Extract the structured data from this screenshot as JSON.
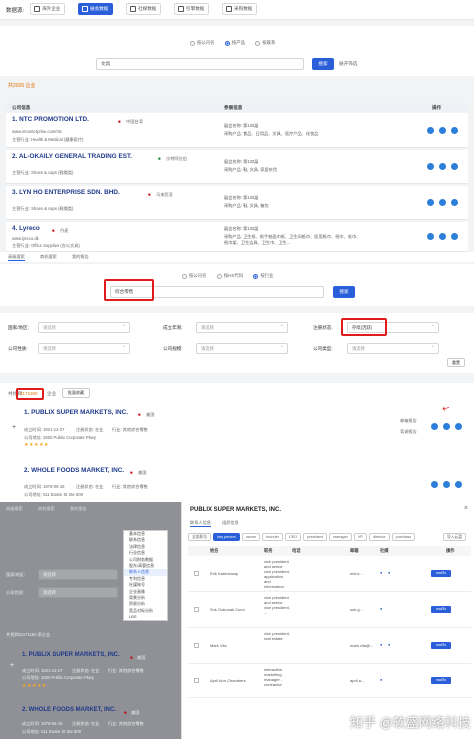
{
  "top": {
    "label": "数据源:",
    "tabs": [
      {
        "label": "海外企业",
        "active": false
      },
      {
        "label": "展会数据",
        "active": true
      },
      {
        "label": "社媒数据",
        "active": false
      },
      {
        "label": "引擎数据",
        "active": false
      },
      {
        "label": "采购数据",
        "active": false
      }
    ]
  },
  "search1": {
    "options": [
      "按公司名",
      "按产品",
      "按联系"
    ],
    "selected": 1,
    "value": "文具",
    "button": "搜索",
    "expand": "展开筛选"
  },
  "results1": {
    "count": "共2026 企业",
    "col_company": "公司信息",
    "col_params": "参展信息",
    "col_actions": "操作",
    "rows": [
      {
        "name": "1. NTC PROMOTION LTD.",
        "country": "中国台湾",
        "url": "www.ntcenterprise.com/ntc",
        "industry": "主营行业: Health & Medical (健康医疗)",
        "p1": "展会名称: 第132届",
        "p2": "采购产品: 食品、日用品、文具、医疗产品、化妆品"
      },
      {
        "name": "2. AL-OKAILY GENERAL TRADING EST.",
        "country": "沙特阿拉伯",
        "url": "",
        "industry": "主营行业: Shoes & caps (鞋帽类)",
        "p1": "展会名称: 第132届",
        "p2": "采购产品: 鞋, 文具, 家居杂货"
      },
      {
        "name": "3. LYN HO ENTERPRISE SDN. BHD.",
        "country": "马来西亚",
        "url": "",
        "industry": "主营行业: Shoes & caps (鞋帽类)",
        "p1": "展会名称: 第132届",
        "p2": "采购产品: 鞋, 文具, 箱包"
      },
      {
        "name": "4. Lyreco",
        "country": "丹麦",
        "url": "www.lyreco.dk",
        "industry": "主营行业: Office Supplies (办公文具)",
        "p1": "展会名称: 第132届",
        "p2": "采购产品: 卫生纸、纸手帕面巾纸、卫生间纸巾、医用纸巾、纸巾、毛巾、纸巾架、卫生洁具、卫生巾、卫生..."
      }
    ],
    "subtabs": [
      "高级搜索",
      "商机搜索",
      "我的报告"
    ]
  },
  "search2": {
    "options": [
      "按公司名",
      "按HS代码",
      "按行业"
    ],
    "selected": 2,
    "value": "综合零售",
    "button": "搜索"
  },
  "filters": {
    "country_label": "国家/地区:",
    "country_value": "请选择",
    "founded_label": "成立年限:",
    "founded_value": "请选择",
    "status_label": "注册状态:",
    "status_value": "存续(活跃)",
    "nature_label": "公司性质:",
    "nature_value": "请选择",
    "size_label": "公司规模:",
    "size_value": "请选择",
    "type_label": "公司类型:",
    "type_value": "请选择",
    "reset": "重置"
  },
  "results2": {
    "count_prefix": "共找到",
    "count": "2171180",
    "count_suffix": "企业",
    "batch": "批量收藏",
    "rows": [
      {
        "name": "1. PUBLIX SUPER MARKETS, INC.",
        "country": "美国",
        "founded": "成立时间: 1921-12-27",
        "reg": "注册状态: 在业",
        "industry": "行业: 其他综合零售",
        "address": "公司地址: 3300 Publix Corporate Pkwy",
        "stars": "★★★★★",
        "l1": "邮箱报告",
        "l2": "背调报告"
      },
      {
        "name": "2. WHOLE FOODS MARKET, INC.",
        "country": "美国",
        "founded": "成立时间: 1978-06-15",
        "reg": "注册状态: 在业",
        "industry": "行业: 其他综合零售",
        "address": "公司地址: 511 Bowie St Ste 800"
      }
    ]
  },
  "overlay": {
    "tabs": [
      "高级搜索",
      "商机搜索",
      "我的报告"
    ],
    "menu": [
      "基本信息",
      "联系信息",
      "法律信息",
      "行业信息",
      "公司财务数据",
      "股东/高管信息",
      "联系人信息",
      "专利信息",
      "社媒账号",
      "企业画像",
      "背景分析",
      "贸易分析",
      "竞品对标分析",
      "LBS"
    ],
    "menu_hl": 6,
    "f1_label": "国家/地区:",
    "f1_value": "请选择",
    "f2_label": "公司性质:",
    "f2_value": "请选择",
    "count": "共找到21171180 家企业",
    "row1": "1. PUBLIX SUPER MARKETS, INC.",
    "row1_country": "美国",
    "row1_founded": "成立时间: 1921-12-27",
    "row1_reg": "注册状态: 在业",
    "row1_ind": "行业: 其他综合零售",
    "row1_addr": "公司地址: 3300 Publix Corporate Pkwy",
    "row1_stars": "★★★★★",
    "row2": "2. WHOLE FOODS MARKET, INC.",
    "row2_country": "美国",
    "row2_founded": "成立时间: 1978-06-15",
    "row2_reg": "注册状态: 在业",
    "row2_ind": "行业: 其他综合零售",
    "row2_addr": "公司地址: 511 Bowie St Ste 800"
  },
  "modal": {
    "title": "PUBLIX SUPER MARKETS, INC.",
    "tabs": [
      "联系人信息",
      "组织信息"
    ],
    "chips": [
      "全部职位",
      "key person",
      "owner",
      "founder",
      "CEO",
      "president",
      "manager",
      "VP",
      "director",
      "purchase"
    ],
    "chip_on": 1,
    "export": "导入云盘",
    "headers": [
      "",
      "姓名",
      "职务",
      "电话",
      "邮箱",
      "社媒",
      "操作"
    ],
    "contacts": [
      {
        "name": "Erik Katenkamp",
        "title": "vice president and senior vice president, application and information technology operations",
        "email": "erik.k...",
        "action": "mailTo"
      },
      {
        "name": "Suk Gokunak Cumi",
        "title": "vice president and senior vice president, ...",
        "email": "suk.g...",
        "action": "mailTo"
      },
      {
        "name": "Mark Vila",
        "title": "vice president, real estate",
        "email": "mark.vila@...",
        "action": "mailTo"
      },
      {
        "name": "April Ann Chambers",
        "title": "interactive marketing manager - contractor",
        "email": "april.a...",
        "action": "mailTo"
      }
    ]
  },
  "watermark": "知乎 @软盛网络科技"
}
